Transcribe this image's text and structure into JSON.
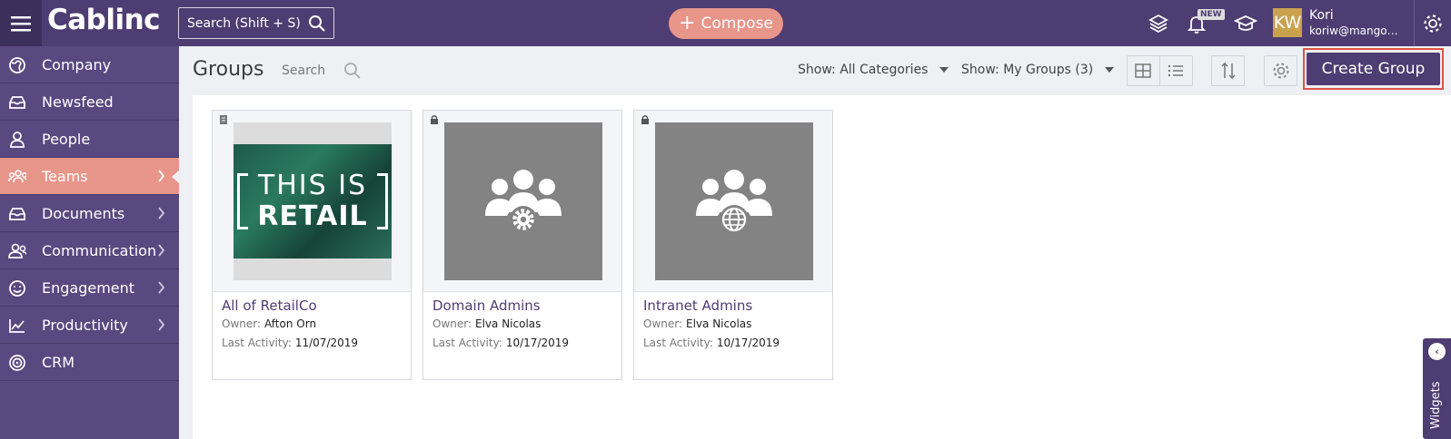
{
  "app": {
    "logo": "Cablinc",
    "search_placeholder": "Search (Shift + S)",
    "compose_label": "Compose",
    "new_badge": "NEW",
    "user": {
      "initials": "KW",
      "name": "Kori",
      "email": "koriw@mangoapps.com"
    }
  },
  "sidebar": {
    "items": [
      {
        "label": "Company",
        "icon": "globe-icon",
        "has_children": false,
        "active": false
      },
      {
        "label": "Newsfeed",
        "icon": "inbox-icon",
        "has_children": false,
        "active": false
      },
      {
        "label": "People",
        "icon": "person-icon",
        "has_children": false,
        "active": false
      },
      {
        "label": "Teams",
        "icon": "team-icon",
        "has_children": true,
        "active": true
      },
      {
        "label": "Documents",
        "icon": "tray-icon",
        "has_children": true,
        "active": false
      },
      {
        "label": "Communication",
        "icon": "people-icon",
        "has_children": true,
        "active": false
      },
      {
        "label": "Engagement",
        "icon": "smile-icon",
        "has_children": true,
        "active": false
      },
      {
        "label": "Productivity",
        "icon": "chart-icon",
        "has_children": true,
        "active": false
      },
      {
        "label": "CRM",
        "icon": "target-icon",
        "has_children": false,
        "active": false
      }
    ]
  },
  "header": {
    "title": "Groups",
    "search_label": "Search",
    "filter_category": {
      "prefix": "Show:",
      "value": "All Categories"
    },
    "filter_groups": {
      "prefix": "Show:",
      "value": "My Groups (3)"
    },
    "create_label": "Create Group"
  },
  "groups": [
    {
      "name": "All of RetailCo",
      "owner_label": "Owner:",
      "owner": "Afton Orn",
      "activity_label": "Last Activity:",
      "last_activity": "11/07/2019",
      "thumb": "retail-image",
      "thumb_text_1": "THIS IS",
      "thumb_text_2": "RETAIL"
    },
    {
      "name": "Domain Admins",
      "owner_label": "Owner:",
      "owner": "Elva Nicolas",
      "activity_label": "Last Activity:",
      "last_activity": "10/17/2019",
      "thumb": "group-gear-icon"
    },
    {
      "name": "Intranet Admins",
      "owner_label": "Owner:",
      "owner": "Elva Nicolas",
      "activity_label": "Last Activity:",
      "last_activity": "10/17/2019",
      "thumb": "group-globe-icon"
    }
  ],
  "widgets": {
    "label": "Widgets"
  },
  "colors": {
    "primary": "#4e3d72",
    "accent": "#e8958a",
    "highlight": "#e05548"
  }
}
